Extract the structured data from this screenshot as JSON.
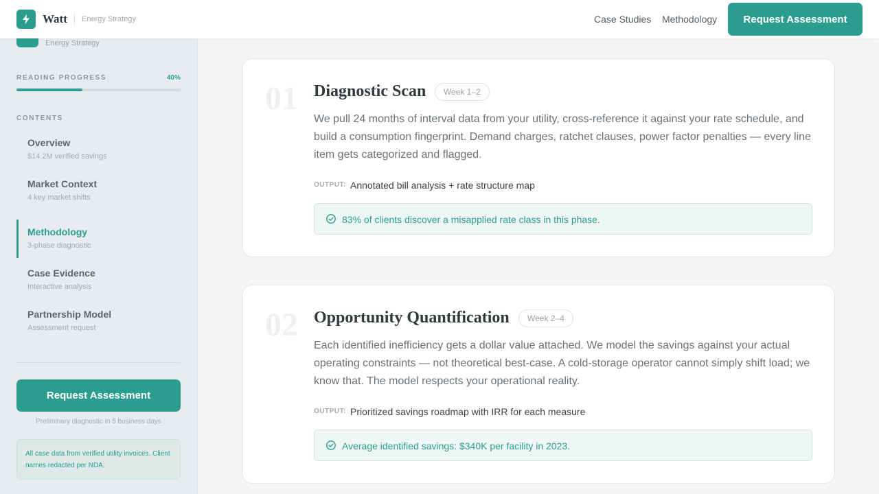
{
  "colors": {
    "accent": "#2a9d8f",
    "sidebar_bg": "#e9ecee",
    "card_bg": "#ffffff"
  },
  "header": {
    "brand": "Watt",
    "tagline": "Energy Strategy",
    "logo_icon": "bolt-icon",
    "nav": [
      "Case Studies",
      "Methodology"
    ],
    "cta": "Request Assessment"
  },
  "sidebar": {
    "tagline": "Energy Strategy",
    "progress_label": "READING PROGRESS",
    "progress_text": "40%",
    "progress_fraction": 0.4,
    "contents_label": "CONTENTS",
    "items": [
      {
        "title": "Overview",
        "subtitle": "$14.2M verified savings",
        "active": false
      },
      {
        "title": "Market Context",
        "subtitle": "4 key market shifts",
        "active": false
      },
      {
        "title": "Methodology",
        "subtitle": "3-phase diagnostic",
        "active": true
      },
      {
        "title": "Case Evidence",
        "subtitle": "Interactive analysis",
        "active": false
      },
      {
        "title": "Partnership Model",
        "subtitle": "Assessment request",
        "active": false
      }
    ],
    "cta": "Request Assessment",
    "cta_note": "Preliminary diagnostic in 5 business days",
    "info": "All case data from verified utility invoices. Client names redacted per NDA."
  },
  "phases": [
    {
      "number": "01",
      "title": "Diagnostic Scan",
      "week": "Week 1–2",
      "description": "We pull 24 months of interval data from your utility, cross-reference it against your rate schedule, and build a consumption fingerprint. Demand charges, ratchet clauses, power factor penalties — every line item gets categorized and flagged.",
      "output_label": "OUTPUT:",
      "output": "Annotated bill analysis + rate structure map",
      "callout": "83% of clients discover a misapplied rate class in this phase.",
      "callout_icon": "check-circle-icon"
    },
    {
      "number": "02",
      "title": "Opportunity Quantification",
      "week": "Week 2–4",
      "description": "Each identified inefficiency gets a dollar value attached. We model the savings against your actual operating constraints — not theoretical best-case. A cold-storage operator cannot simply shift load; we know that. The model respects your operational reality.",
      "output_label": "OUTPUT:",
      "output": "Prioritized savings roadmap with IRR for each measure",
      "callout": "Average identified savings: $340K per facility in 2023.",
      "callout_icon": "check-circle-icon"
    }
  ]
}
